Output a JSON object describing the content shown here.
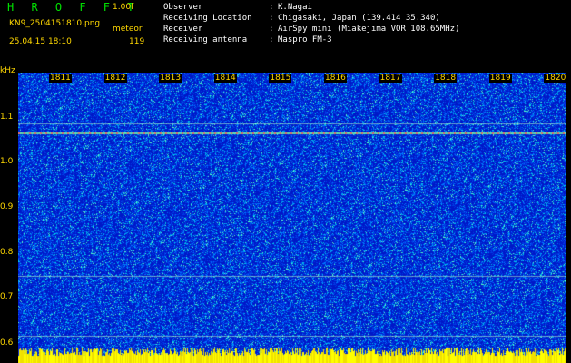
{
  "header": {
    "app_title": "H R O F F T",
    "version": "1.00f",
    "filename": "KN9_2504151810.png",
    "mode": "meteor",
    "datetime": "25.04.15 18:10",
    "count": "119"
  },
  "info": [
    {
      "label": "Observer",
      "value": "K.Nagai"
    },
    {
      "label": "Receiving Location",
      "value": "Chigasaki, Japan (139.414 35.340)"
    },
    {
      "label": "Receiver",
      "value": "AirSpy mini (Miakejima VOR 108.65MHz)"
    },
    {
      "label": "Receiving antenna",
      "value": "Maspro FM-3"
    }
  ],
  "axis": {
    "y_unit": "kHz",
    "y_ticks": [
      "1.1",
      "1.0",
      "0.9",
      "0.8",
      "0.7",
      "0.6"
    ],
    "x_ticks": [
      "1811",
      "1812",
      "1813",
      "1814",
      "1815",
      "1816",
      "1817",
      "1818",
      "1819",
      "1820"
    ]
  },
  "colors": {
    "background": "#0018c8",
    "label": "#ffd800",
    "title": "#00e000"
  }
}
